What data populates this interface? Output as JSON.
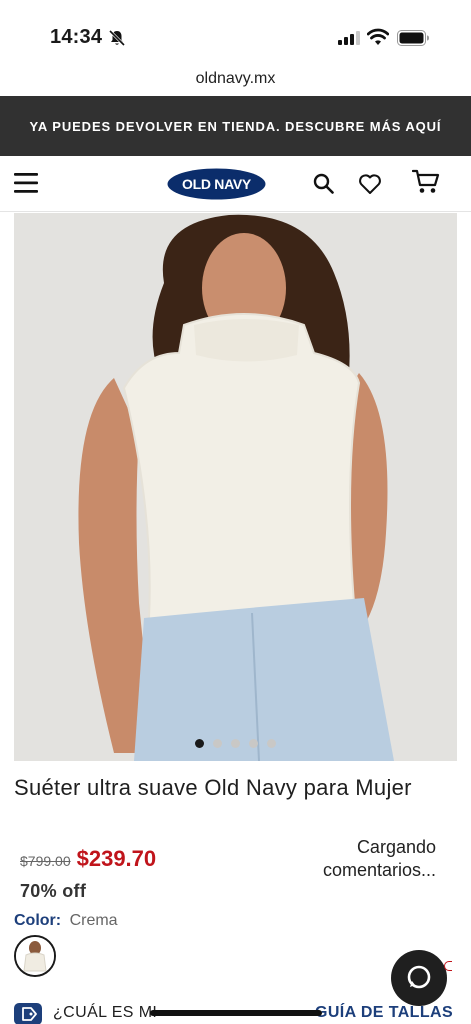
{
  "status_bar": {
    "time": "14:34"
  },
  "browser": {
    "url": "oldnavy.mx"
  },
  "promo_banner": {
    "text": "YA PUEDES DEVOLVER EN TIENDA. DESCUBRE MÁS AQUÍ"
  },
  "header": {
    "logo_text": "OLD NAVY",
    "icons": [
      "menu-icon",
      "search-icon",
      "heart-icon",
      "cart-icon"
    ]
  },
  "product": {
    "title": "Suéter ultra suave Old Navy para Mujer",
    "price_original": "$799.00",
    "price_sale": "$239.70",
    "discount": "70% off",
    "reviews_status": "Cargando comentarios...",
    "color_label": "Color:",
    "color_value": "Crema",
    "carousel": {
      "total": 5,
      "active": 1
    }
  },
  "size_help": {
    "question": "¿CUÁL ES MI",
    "guide_link": "GUÍA DE TALLAS"
  },
  "colors": {
    "banner_bg": "#313131",
    "brand_navy": "#1d3f7b",
    "sale_red": "#c0141b"
  }
}
